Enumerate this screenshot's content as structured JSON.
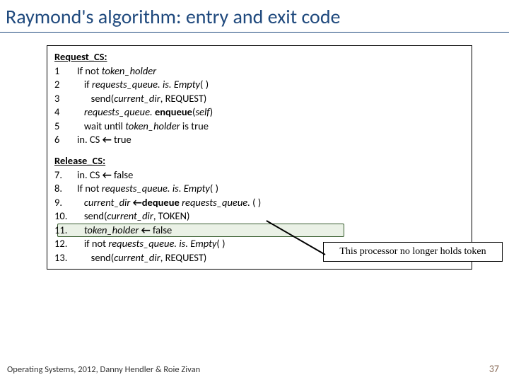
{
  "title": "Raymond's algorithm: entry and exit code",
  "request": {
    "heading": "Request_CS:",
    "lines": [
      {
        "n": "1",
        "pre": "",
        "text": "If not ",
        "i": "token_holder"
      },
      {
        "n": "2",
        "pre": "   ",
        "text": "if ",
        "i": "requests_queue. is. Empty",
        "after": "( )"
      },
      {
        "n": "3",
        "pre": "      ",
        "text": "send(",
        "i": "current_dir",
        "after": ", REQUEST)"
      },
      {
        "n": "4",
        "pre": "   ",
        "text": "",
        "i": "requests_queue. ",
        "bold": "enqueue",
        "after2": "(",
        "i2": "self",
        "after3": ")"
      },
      {
        "n": "5",
        "pre": "   ",
        "text": "wait until ",
        "i": "token_holder",
        "after": " is true"
      },
      {
        "n": "6",
        "pre": "",
        "text": "in. CS ",
        "arrow": "←",
        "after": " true"
      }
    ]
  },
  "release": {
    "heading": "Release_CS:",
    "lines": [
      {
        "n": "7.",
        "pre": "",
        "text": "in. CS ",
        "arrow": "←",
        "after": " false"
      },
      {
        "n": "8.",
        "pre": "",
        "text": "If not ",
        "i": "requests_queue. is. Empty",
        "after": "( )"
      },
      {
        "n": "9.",
        "pre": "   ",
        "text": "",
        "i": "current_dir ",
        "arrow": "←",
        "i2": " requests_queue. ",
        "bold": "dequeue",
        "after3": "( )"
      },
      {
        "n": "10.",
        "pre": "   ",
        "text": "send(",
        "i": "current_dir",
        "after": ", TOKEN)"
      },
      {
        "n": "11.",
        "pre": "   ",
        "text": "",
        "i": "token_holder ",
        "arrow": "←",
        "after": " false",
        "hl": true
      },
      {
        "n": "12.",
        "pre": "   ",
        "text": "if not ",
        "i": "requests_queue. is. Empty",
        "after": "( )"
      },
      {
        "n": "13.",
        "pre": "      ",
        "text": "send(",
        "i": "current_dir",
        "after": ", REQUEST)"
      }
    ]
  },
  "callout": "This processor no longer holds token",
  "footer": "Operating Systems, 2012, Danny Hendler & Roie Zivan",
  "pagenum": "37"
}
